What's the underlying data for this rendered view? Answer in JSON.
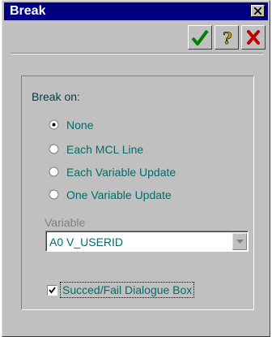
{
  "window": {
    "title": "Break"
  },
  "toolbar": {
    "ok_icon": "checkmark-icon",
    "help_icon": "question-mark-icon",
    "cancel_icon": "x-icon"
  },
  "panel": {
    "break_on_label": "Break on:",
    "options": [
      {
        "label": "None",
        "selected": true
      },
      {
        "label": "Each MCL Line",
        "selected": false
      },
      {
        "label": "Each Variable Update",
        "selected": false
      },
      {
        "label": "One Variable Update",
        "selected": false
      }
    ],
    "variable_label": "Variable",
    "variable_value": "A0 V_USERID",
    "checkbox_label": "Succed/Fail Dialogue Box",
    "checkbox_checked": true
  },
  "colors": {
    "titlebar": "#000080",
    "ok": "#008000",
    "help": "#c0a000",
    "cancel": "#c00000",
    "text_teal": "#006c6c"
  }
}
